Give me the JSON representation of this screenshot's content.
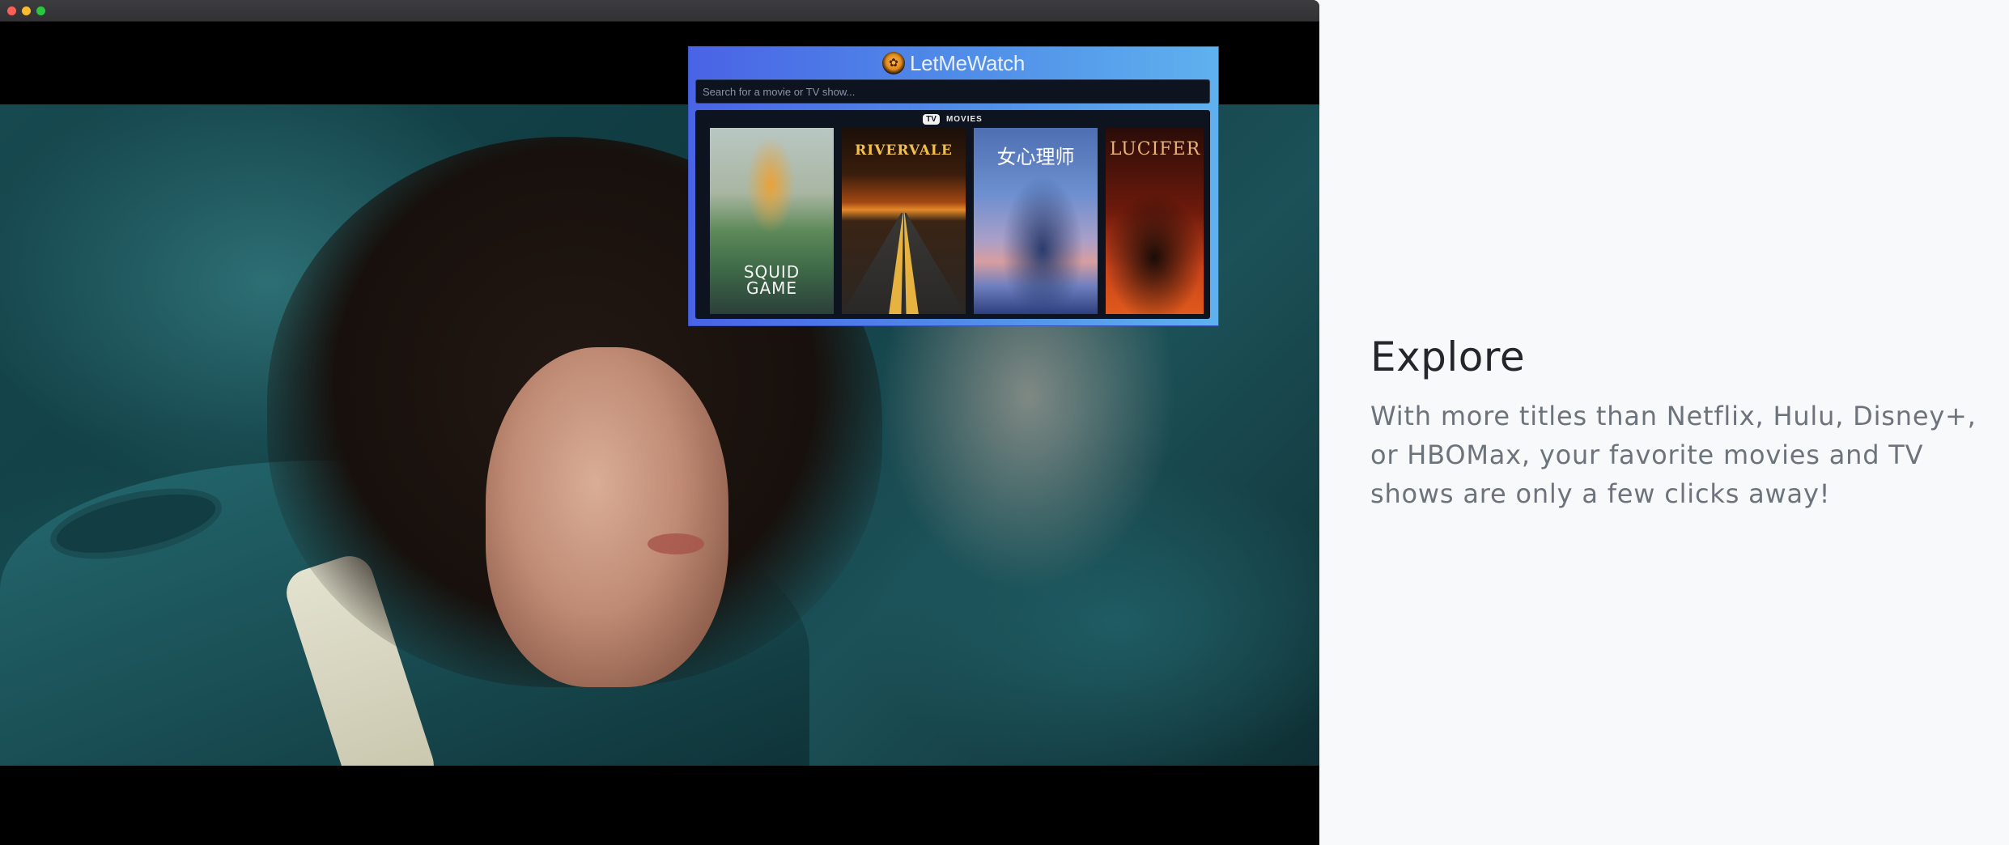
{
  "window": {
    "buttons": [
      "close",
      "minimize",
      "maximize"
    ]
  },
  "popup": {
    "app_title": "LetMeWatch",
    "logo_icon": "popcorn-icon",
    "search": {
      "placeholder": "Search for a movie or TV show...",
      "value": ""
    },
    "type_toggle": {
      "tv_label": "TV",
      "movies_label": "MOVIES",
      "selected": "TV"
    },
    "posters": [
      {
        "title_line1": "SQUID",
        "title_line2": "GAME"
      },
      {
        "title": "RIVERVALE"
      },
      {
        "title": "女心理师"
      },
      {
        "title": "LUCIFER"
      }
    ]
  },
  "marketing": {
    "heading": "Explore",
    "body": "With more titles than Netflix, Hulu, Disney+, or HBOMax, your favorite movies and TV shows are only a few clicks away!"
  }
}
